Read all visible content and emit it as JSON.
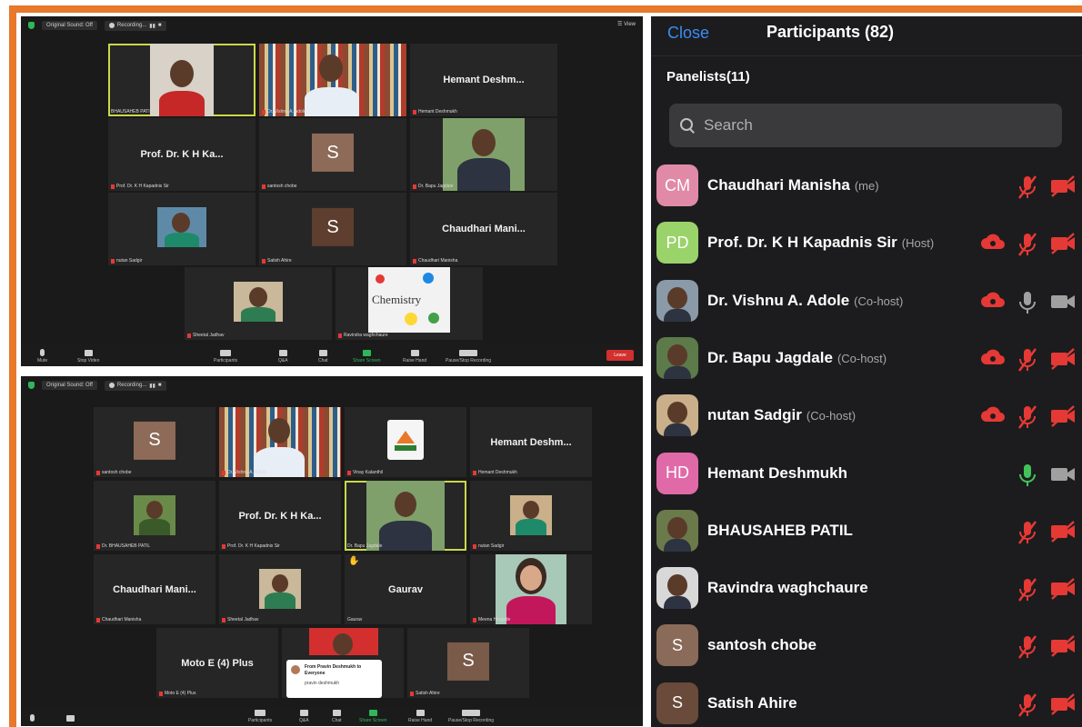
{
  "top_window": {
    "original_sound": "Original Sound: Off",
    "recording": "Recording...",
    "view": "View",
    "tiles": [
      {
        "big": "",
        "label": "BHAUSAHEB PATIL"
      },
      {
        "big": "",
        "label": "Dr. Vishnu A. Adole"
      },
      {
        "big": "Hemant Deshm...",
        "label": "Hemant Deshmukh"
      },
      {
        "big": "Prof. Dr. K H Ka...",
        "label": "Prof. Dr. K H Kapadnis Sir"
      },
      {
        "big": "S",
        "label": "santosh chobe"
      },
      {
        "big": "",
        "label": "Dr. Bapu Jagdale"
      },
      {
        "big": "",
        "label": "nutan Sadgir"
      },
      {
        "big": "S",
        "label": "Satish Ahire"
      },
      {
        "big": "Chaudhari Mani...",
        "label": "Chaudhari Manisha"
      },
      {
        "big": "",
        "label": "Sheetal Jadhav"
      },
      {
        "big": "",
        "label": "Ravindra waghchaure"
      }
    ],
    "controls": {
      "mute": "Mute",
      "stop_video": "Stop Video",
      "participants": "Participants",
      "participants_count": "79",
      "qa": "Q&A",
      "chat": "Chat",
      "share_screen": "Share Screen",
      "raise_hand": "Raise Hand",
      "pause_recording": "Pause/Stop Recording",
      "leave": "Leave"
    }
  },
  "bottom_window": {
    "original_sound": "Original Sound: Off",
    "recording": "Recording...",
    "tiles": [
      {
        "big": "S",
        "label": "santosh chobe"
      },
      {
        "big": "",
        "label": "Dr. Vishnu A. Adole"
      },
      {
        "big": "",
        "label": "Vinay Kalanthil"
      },
      {
        "big": "Hemant Deshm...",
        "label": "Hemant Deshmukh"
      },
      {
        "big": "",
        "label": "Dr. BHAUSAHEB PATIL"
      },
      {
        "big": "Prof. Dr. K H Ka...",
        "label": "Prof. Dr. K H Kapadnis Sir"
      },
      {
        "big": "",
        "label": "Dr. Bapu Jagdale"
      },
      {
        "big": "",
        "label": "nutan Sadgir"
      },
      {
        "big": "Chaudhari Mani...",
        "label": "Chaudhari Manisha"
      },
      {
        "big": "",
        "label": "Sheetal Jadhav"
      },
      {
        "big": "Gaurav",
        "label": "Gaurav"
      },
      {
        "big": "",
        "label": "Meena Hingade"
      },
      {
        "big": "Moto E (4) Plus",
        "label": "Moto E (4) Plus"
      },
      {
        "big": "",
        "label": ""
      },
      {
        "big": "S",
        "label": "Satish Ahire"
      }
    ],
    "chat_popup": {
      "title": "From Pravin Deshmukh to Everyone",
      "message": "pravin deshmukh"
    },
    "controls": {
      "participants": "Participants",
      "participants_count": "80",
      "qa": "Q&A",
      "chat": "Chat",
      "share_screen": "Share Screen",
      "raise_hand": "Raise Hand",
      "pause_recording": "Pause/Stop Recording"
    }
  },
  "panel": {
    "close": "Close",
    "title": "Participants (82)",
    "panelists": "Panelists(11)",
    "search_placeholder": "Search",
    "participants": [
      {
        "initials": "CM",
        "name": "Chaudhari Manisha",
        "role": "(me)",
        "avatar_color": "#e08aa8",
        "cloud": false,
        "mic": "muted",
        "cam": "off"
      },
      {
        "initials": "PD",
        "name": "Prof. Dr. K H Kapadnis Sir",
        "role": "(Host)",
        "avatar_color": "#9bd36b",
        "cloud": true,
        "mic": "muted",
        "cam": "off"
      },
      {
        "initials": "",
        "name": "Dr. Vishnu A. Adole",
        "role": "(Co-host)",
        "avatar_color": "#8a9aa8",
        "cloud": true,
        "mic": "on-gray",
        "cam": "on-gray"
      },
      {
        "initials": "",
        "name": "Dr. Bapu Jagdale",
        "role": "(Co-host)",
        "avatar_color": "#5d7a4a",
        "cloud": true,
        "mic": "muted",
        "cam": "off"
      },
      {
        "initials": "",
        "name": "nutan Sadgir",
        "role": "(Co-host)",
        "avatar_color": "#c9b08a",
        "cloud": true,
        "mic": "muted",
        "cam": "off"
      },
      {
        "initials": "HD",
        "name": "Hemant Deshmukh",
        "role": "",
        "avatar_color": "#e06aa8",
        "cloud": false,
        "mic": "on-green",
        "cam": "on-gray"
      },
      {
        "initials": "",
        "name": "BHAUSAHEB PATIL",
        "role": "",
        "avatar_color": "#6a7a4a",
        "cloud": false,
        "mic": "muted",
        "cam": "off"
      },
      {
        "initials": "",
        "name": "Ravindra waghchaure",
        "role": "",
        "avatar_color": "#d8d8d8",
        "cloud": false,
        "mic": "muted",
        "cam": "off"
      },
      {
        "initials": "S",
        "name": "santosh chobe",
        "role": "",
        "avatar_color": "#8a6a58",
        "cloud": false,
        "mic": "muted",
        "cam": "off"
      },
      {
        "initials": "S",
        "name": "Satish Ahire",
        "role": "",
        "avatar_color": "#6a4a3a",
        "cloud": false,
        "mic": "muted",
        "cam": "off"
      }
    ]
  },
  "colors": {
    "accent": "#e8782a",
    "muted_red": "#e53935",
    "close_blue": "#3a8cf5",
    "active_tile": "#c9d94a"
  }
}
